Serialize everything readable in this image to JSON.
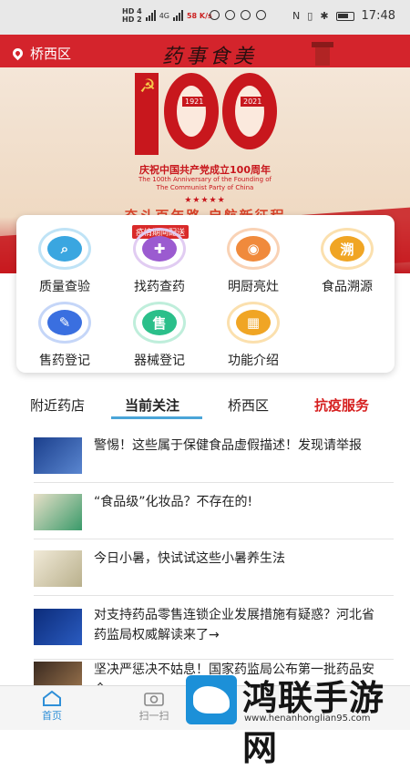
{
  "status_bar": {
    "time": "17:48",
    "network": "4G",
    "hd1": "HD 4",
    "hd2": "HD 2",
    "speed": "58 K/s"
  },
  "header": {
    "location": "桥西区"
  },
  "banner": {
    "calligraphy": "药事食美",
    "year_left": "1921",
    "year_right": "2021",
    "title_cn": "庆祝中国共产党成立100周年",
    "title_en": "The 100th Anniversary of the Founding of The Communist Party of China",
    "stars": "★★★★★",
    "slogan": "奋斗百年路  启航新征程"
  },
  "functions": [
    {
      "label": "质量查验",
      "icon": "search-icon",
      "color": "#3aa6e0"
    },
    {
      "label": "找药查药",
      "icon": "medicine-box-icon",
      "color": "#9b5bd0",
      "tag": "疫情期间配送"
    },
    {
      "label": "明厨亮灶",
      "icon": "camera-icon",
      "color": "#f08a3c"
    },
    {
      "label": "食品溯源",
      "icon": "trace-icon",
      "color": "#f0a524",
      "glyph": "溯"
    },
    {
      "label": "售药登记",
      "icon": "register-icon",
      "color": "#3a6fe0"
    },
    {
      "label": "器械登记",
      "icon": "device-icon",
      "color": "#2bbf8a",
      "glyph": "售"
    },
    {
      "label": "功能介绍",
      "icon": "grid-icon",
      "color": "#f0a524"
    }
  ],
  "tabs": [
    {
      "label": "附近药店"
    },
    {
      "label": "当前关注"
    },
    {
      "label": "桥西区"
    },
    {
      "label": "抗疫服务"
    }
  ],
  "news": [
    {
      "title": "警惕！这些属于保健食品虚假描述！发现请举报"
    },
    {
      "title": "“食品级”化妆品？不存在的!"
    },
    {
      "title": "今日小暑，快试试这些小暑养生法"
    },
    {
      "title": "对支持药品零售连锁企业发展措施有疑惑？河北省药监局权威解读来了→"
    },
    {
      "title": "坚决严惩决不姑息！国家药监局公布第一批药品安全..."
    }
  ],
  "bottom_nav": [
    {
      "label": "首页"
    },
    {
      "label": "扫一扫"
    }
  ],
  "watermark": {
    "name": "鸿联手游网",
    "url": "www.henanhonglian95.com"
  },
  "colors": {
    "brand_red": "#d4242c",
    "tab_underline": "#4aa5d8",
    "tab_red": "#d61f1f",
    "nav_active": "#2f8fd8"
  }
}
